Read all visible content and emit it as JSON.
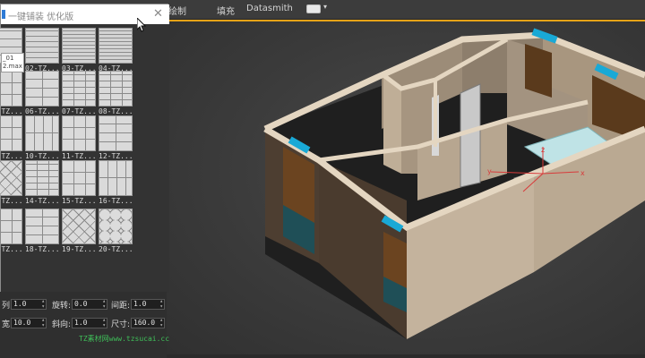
{
  "menubar": {
    "items": [
      "绘制",
      "填充",
      "Datasmith"
    ]
  },
  "panel": {
    "title": "一键铺装  优化版",
    "close_icon": "close-icon",
    "tooltip_lines": [
      "_01",
      "2.max"
    ],
    "tiles": [
      {
        "label": "01-TZ...",
        "pattern": "p1"
      },
      {
        "label": "02-TZ...",
        "pattern": "p2"
      },
      {
        "label": "03-TZ...",
        "pattern": "p3"
      },
      {
        "label": "04-TZ...",
        "pattern": "p3"
      },
      {
        "label": "05-TZ...",
        "pattern": "p4"
      },
      {
        "label": "06-TZ...",
        "pattern": "p5"
      },
      {
        "label": "07-TZ...",
        "pattern": "p6"
      },
      {
        "label": "08-TZ...",
        "pattern": "p6"
      },
      {
        "label": "09-TZ...",
        "pattern": "p4"
      },
      {
        "label": "10-TZ...",
        "pattern": "p7"
      },
      {
        "label": "11-TZ...",
        "pattern": "p4"
      },
      {
        "label": "12-TZ...",
        "pattern": "p5"
      },
      {
        "label": "13-TZ...",
        "pattern": "p8"
      },
      {
        "label": "14-TZ...",
        "pattern": "p6"
      },
      {
        "label": "15-TZ...",
        "pattern": "p4"
      },
      {
        "label": "16-TZ...",
        "pattern": "p7"
      },
      {
        "label": "17-TZ...",
        "pattern": "p4"
      },
      {
        "label": "18-TZ...",
        "pattern": "p5"
      },
      {
        "label": "19-TZ...",
        "pattern": "p8"
      },
      {
        "label": "20-TZ...",
        "pattern": "p9"
      }
    ]
  },
  "params": {
    "row1": [
      {
        "label": "列:",
        "value": "1.0"
      },
      {
        "label": "旋转:",
        "value": "0.0"
      },
      {
        "label": "间距:",
        "value": "1.0"
      }
    ],
    "row2": [
      {
        "label": "宽:",
        "value": "10.0"
      },
      {
        "label": "斜向:",
        "value": "1.0"
      },
      {
        "label": "尺寸:",
        "value": "160.0"
      }
    ],
    "watermark": "TZ素材网www.tzsucai.cc"
  },
  "viewport": {
    "accent_color": "#e6a317",
    "wall_color": "#b5a48f",
    "wall_top_color": "#e4d6c1",
    "marker_color": "#19a9d6",
    "window_color": "#5a3a1c",
    "glass_color": "#9fd4d8",
    "gizmo_color": "#d83a3a",
    "axis_labels": [
      "z",
      "x",
      "y"
    ]
  }
}
